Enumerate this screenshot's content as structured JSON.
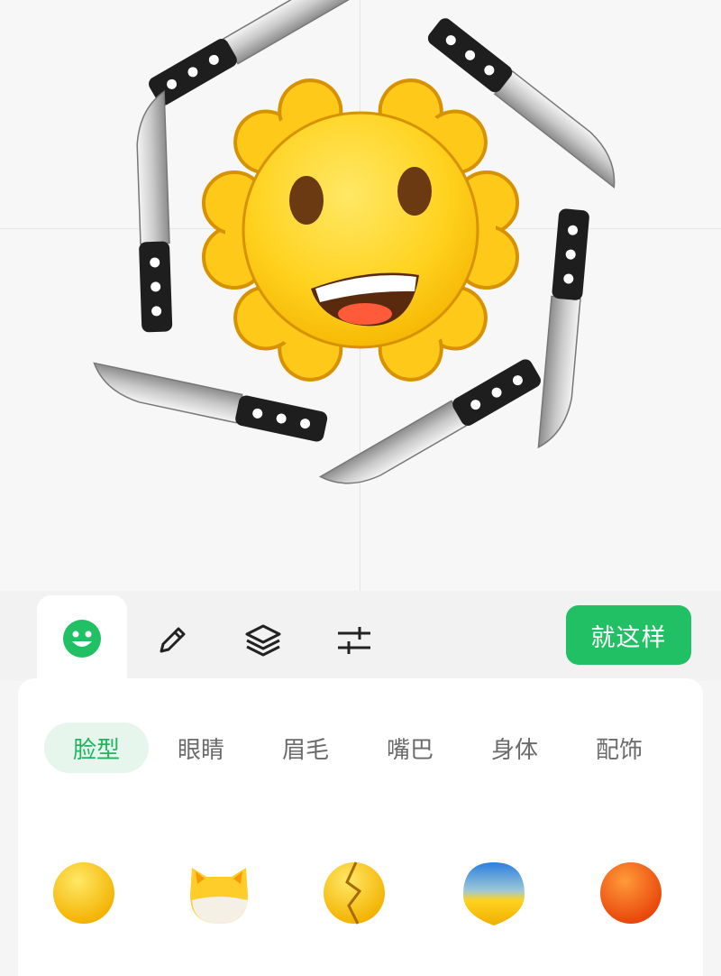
{
  "toolbar": {
    "tabs": [
      {
        "name": "face",
        "icon": "smiley-icon",
        "active": true
      },
      {
        "name": "draw",
        "icon": "pencil-icon",
        "active": false
      },
      {
        "name": "layers",
        "icon": "layers-icon",
        "active": false
      },
      {
        "name": "adjust",
        "icon": "sliders-icon",
        "active": false
      }
    ],
    "done_label": "就这样"
  },
  "categories": [
    {
      "label": "脸型",
      "active": true
    },
    {
      "label": "眼睛",
      "active": false
    },
    {
      "label": "眉毛",
      "active": false
    },
    {
      "label": "嘴巴",
      "active": false
    },
    {
      "label": "身体",
      "active": false
    },
    {
      "label": "配饰",
      "active": false
    }
  ],
  "face_options": [
    {
      "name": "round-yellow"
    },
    {
      "name": "cat-yellow"
    },
    {
      "name": "cracked-yellow"
    },
    {
      "name": "blue-yellow-gradient"
    },
    {
      "name": "orange-red"
    }
  ],
  "colors": {
    "accent": "#21c064",
    "accent_light": "#e6f6ec",
    "face_yellow": "#ffd21f",
    "outline": "#d69200"
  }
}
